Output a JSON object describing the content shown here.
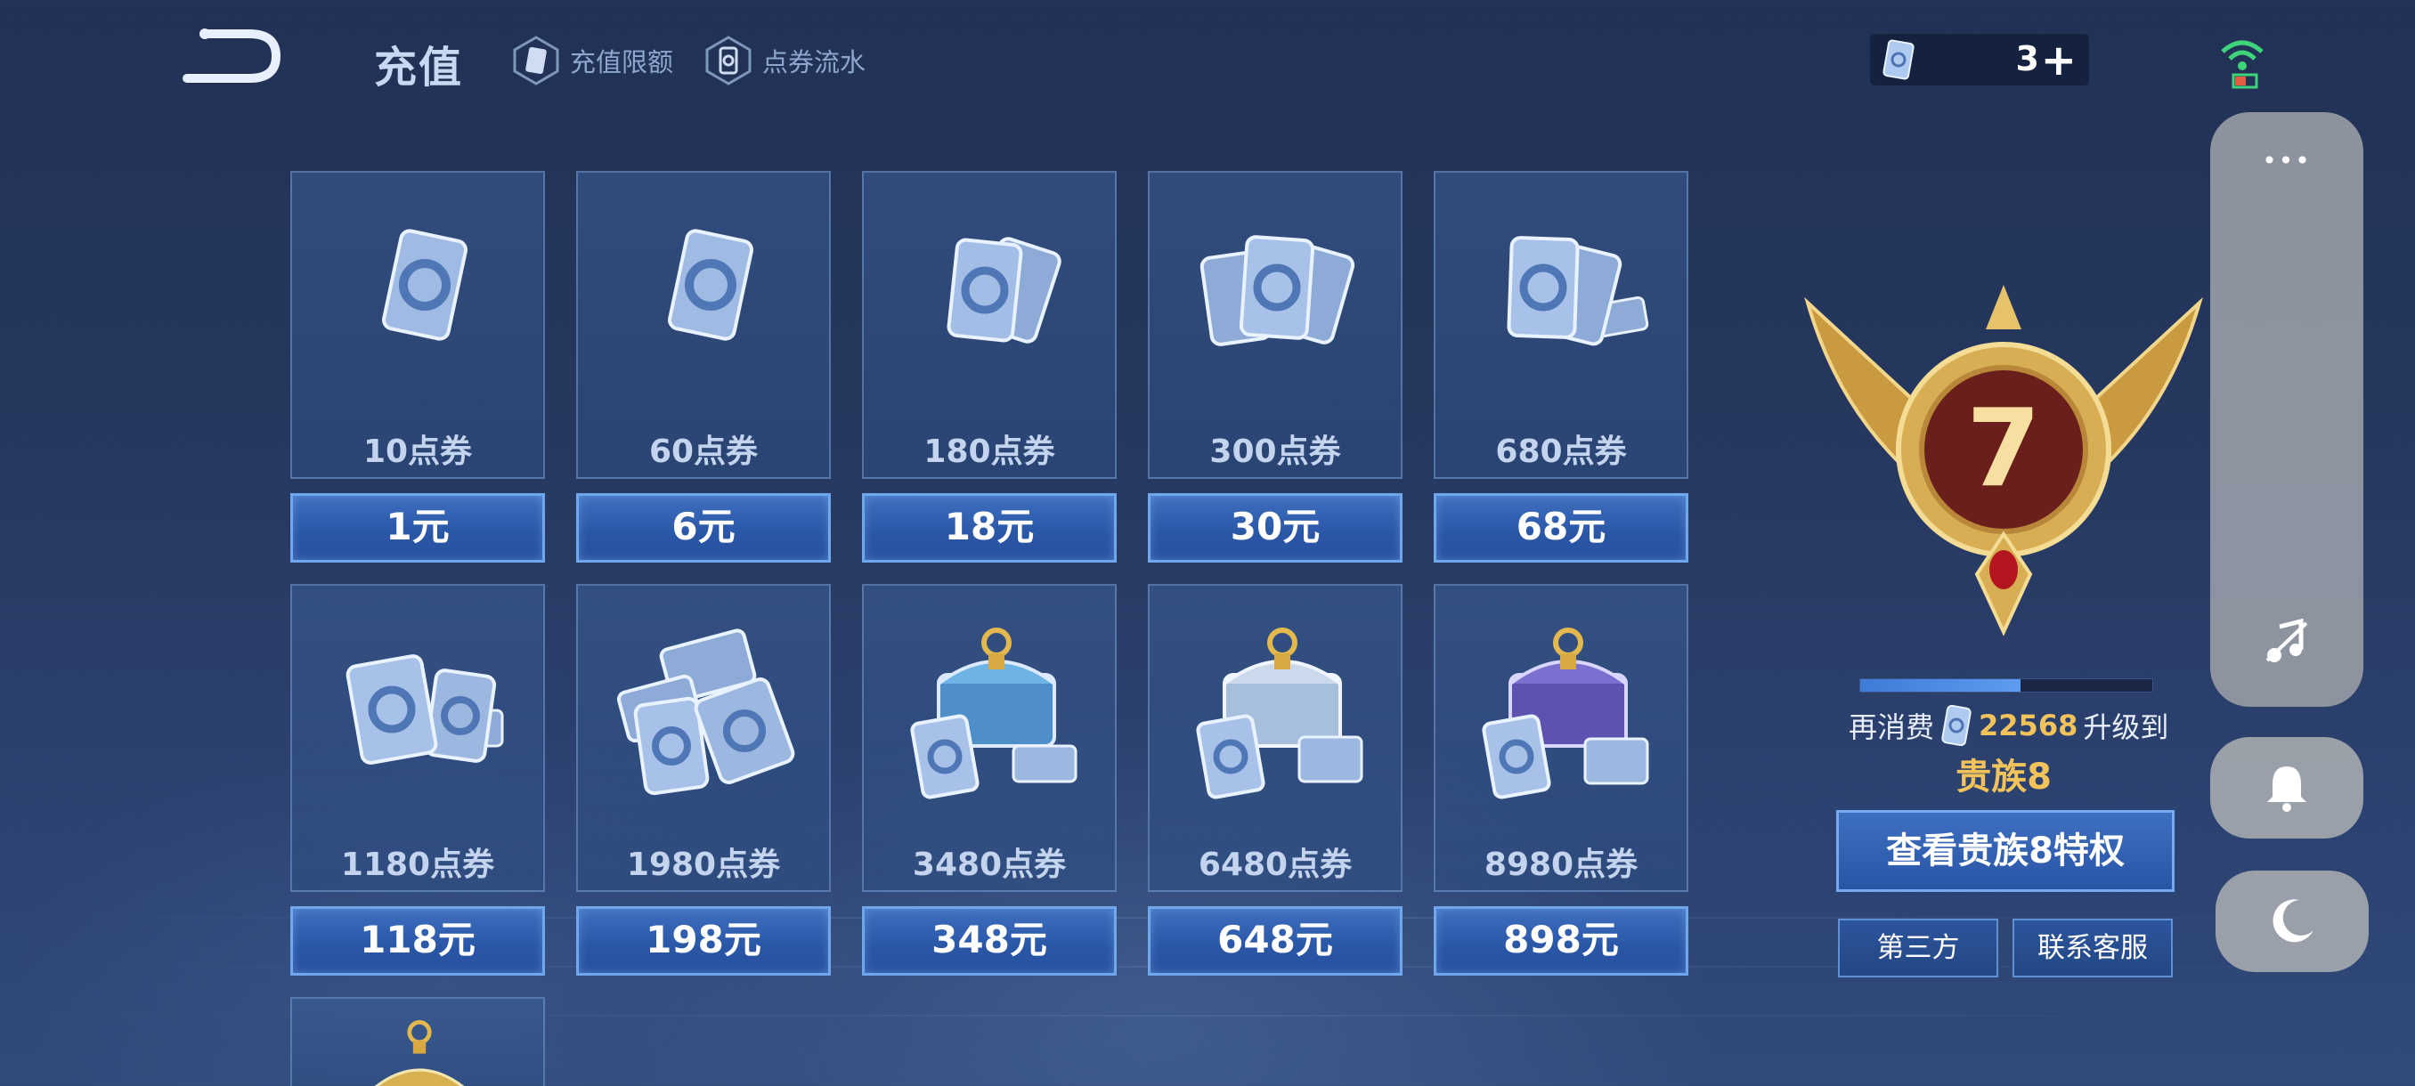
{
  "header": {
    "title": "充值",
    "links": [
      {
        "label": "充值限额"
      },
      {
        "label": "点券流水"
      }
    ],
    "balance": {
      "value": "3",
      "plus": "+"
    }
  },
  "packages": [
    {
      "amount": "10点券",
      "price": "1元"
    },
    {
      "amount": "60点券",
      "price": "6元"
    },
    {
      "amount": "180点券",
      "price": "18元"
    },
    {
      "amount": "300点券",
      "price": "30元"
    },
    {
      "amount": "680点券",
      "price": "68元"
    },
    {
      "amount": "1180点券",
      "price": "118元"
    },
    {
      "amount": "1980点券",
      "price": "198元"
    },
    {
      "amount": "3480点券",
      "price": "348元"
    },
    {
      "amount": "6480点券",
      "price": "648元"
    },
    {
      "amount": "8980点券",
      "price": "898元"
    }
  ],
  "noble": {
    "current_level": "7",
    "progress": 0.55,
    "prefix": "再消费",
    "remaining": "22568",
    "suffix": "升级到",
    "next_level": "贵族8",
    "view_button": "查看贵族8特权",
    "third_party": "第三方",
    "contact": "联系客服"
  },
  "system_panel": {
    "dots": "•••"
  },
  "colors": {
    "price_button": "#2a56a6",
    "accent_gold": "#f2c35b",
    "background": "#26385f"
  }
}
